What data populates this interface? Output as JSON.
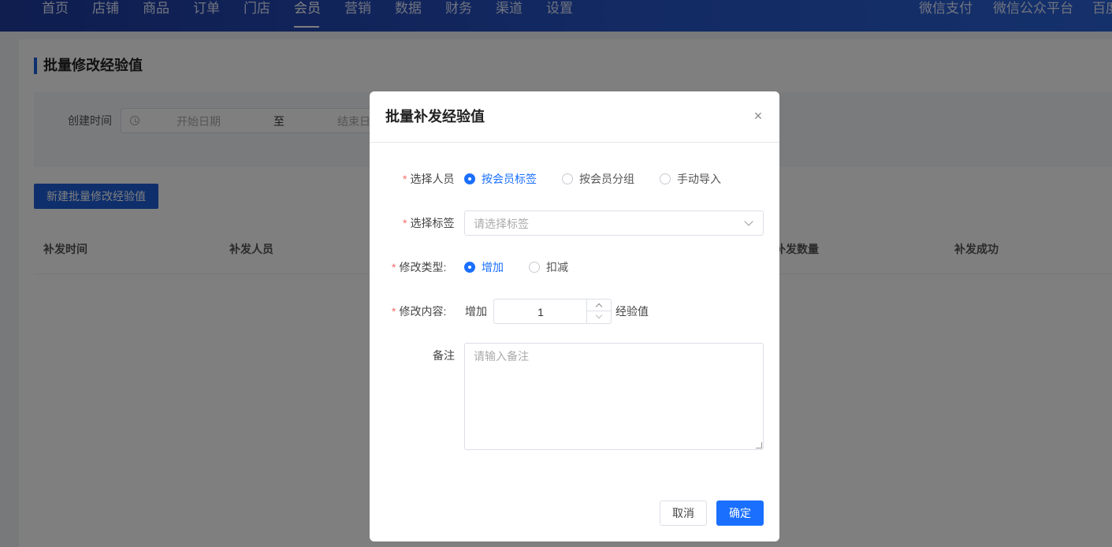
{
  "nav": {
    "items": [
      "首页",
      "店铺",
      "商品",
      "订单",
      "门店",
      "会员",
      "营销",
      "数据",
      "财务",
      "渠道",
      "设置"
    ],
    "active_index": 5,
    "right_items": [
      "微信支付",
      "微信公众平台",
      "百度"
    ]
  },
  "page": {
    "title": "批量修改经验值",
    "filter": {
      "label": "创建时间",
      "start_placeholder": "开始日期",
      "separator": "至",
      "end_placeholder": "结束日"
    },
    "new_button": "新建批量修改经验值",
    "table": {
      "columns": [
        "补发时间",
        "补发人员",
        "补发数量",
        "补发成功"
      ]
    }
  },
  "dialog": {
    "title": "批量补发经验值",
    "close_icon": "close-icon",
    "fields": {
      "members": {
        "label": "选择人员",
        "options": [
          "按会员标签",
          "按会员分组",
          "手动导入"
        ],
        "selected": "按会员标签"
      },
      "tag": {
        "label": "选择标签",
        "placeholder": "请选择标签"
      },
      "type": {
        "label": "修改类型:",
        "options": [
          "增加",
          "扣减"
        ],
        "selected": "增加"
      },
      "content": {
        "label": "修改内容:",
        "prefix": "增加",
        "value": "1",
        "suffix": "经验值"
      },
      "remark": {
        "label": "备注",
        "placeholder": "请输入备注"
      }
    },
    "cancel": "取消",
    "confirm": "确定"
  },
  "colors": {
    "nav": "#2250c0",
    "primary": "#1a6fff",
    "required": "#f56c6c"
  }
}
